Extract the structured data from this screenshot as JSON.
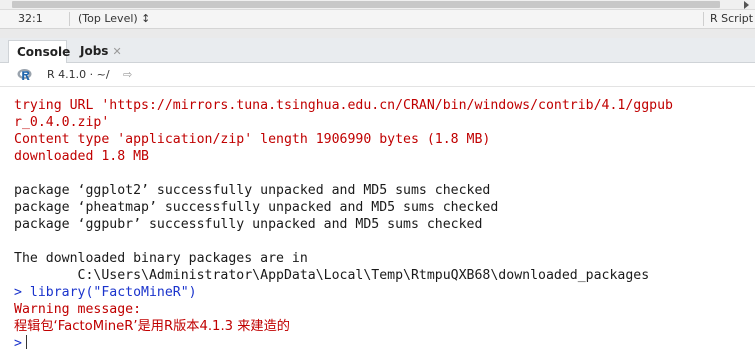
{
  "editor_status": {
    "position": "32:1",
    "scope": "(Top Level) ↕",
    "file_type": "R Script"
  },
  "tabs": [
    {
      "label": "Console"
    },
    {
      "label": "Jobs"
    }
  ],
  "toolbar": {
    "version": "R 4.1.0",
    "separator": "·",
    "path": "~/"
  },
  "console": {
    "lines": [
      {
        "text": "trying URL 'https://mirrors.tuna.tsinghua.edu.cn/CRAN/bin/windows/contrib/4.1/ggpub",
        "kind": "red"
      },
      {
        "text": "r_0.4.0.zip'",
        "kind": "red"
      },
      {
        "text": "Content type 'application/zip' length 1906990 bytes (1.8 MB)",
        "kind": "red"
      },
      {
        "text": "downloaded 1.8 MB",
        "kind": "red"
      },
      {
        "text": "",
        "kind": "blk"
      },
      {
        "text": "package ‘ggplot2’ successfully unpacked and MD5 sums checked",
        "kind": "blk"
      },
      {
        "text": "package ‘pheatmap’ successfully unpacked and MD5 sums checked",
        "kind": "blk"
      },
      {
        "text": "package ‘ggpubr’ successfully unpacked and MD5 sums checked",
        "kind": "blk"
      },
      {
        "text": "",
        "kind": "blk"
      },
      {
        "text": "The downloaded binary packages are in",
        "kind": "blk"
      },
      {
        "text": "        C:\\Users\\Administrator\\AppData\\Local\\Temp\\RtmpuQXB68\\downloaded_packages",
        "kind": "blk"
      },
      {
        "text": "> library(\"FactoMineR\")",
        "kind": "prompt"
      },
      {
        "text": "Warning message:",
        "kind": "red"
      },
      {
        "text": "程辑包‘FactoMineR’是用R版本4.1.3 来建造的",
        "kind": "red"
      },
      {
        "text": ">",
        "kind": "prompt"
      }
    ]
  }
}
